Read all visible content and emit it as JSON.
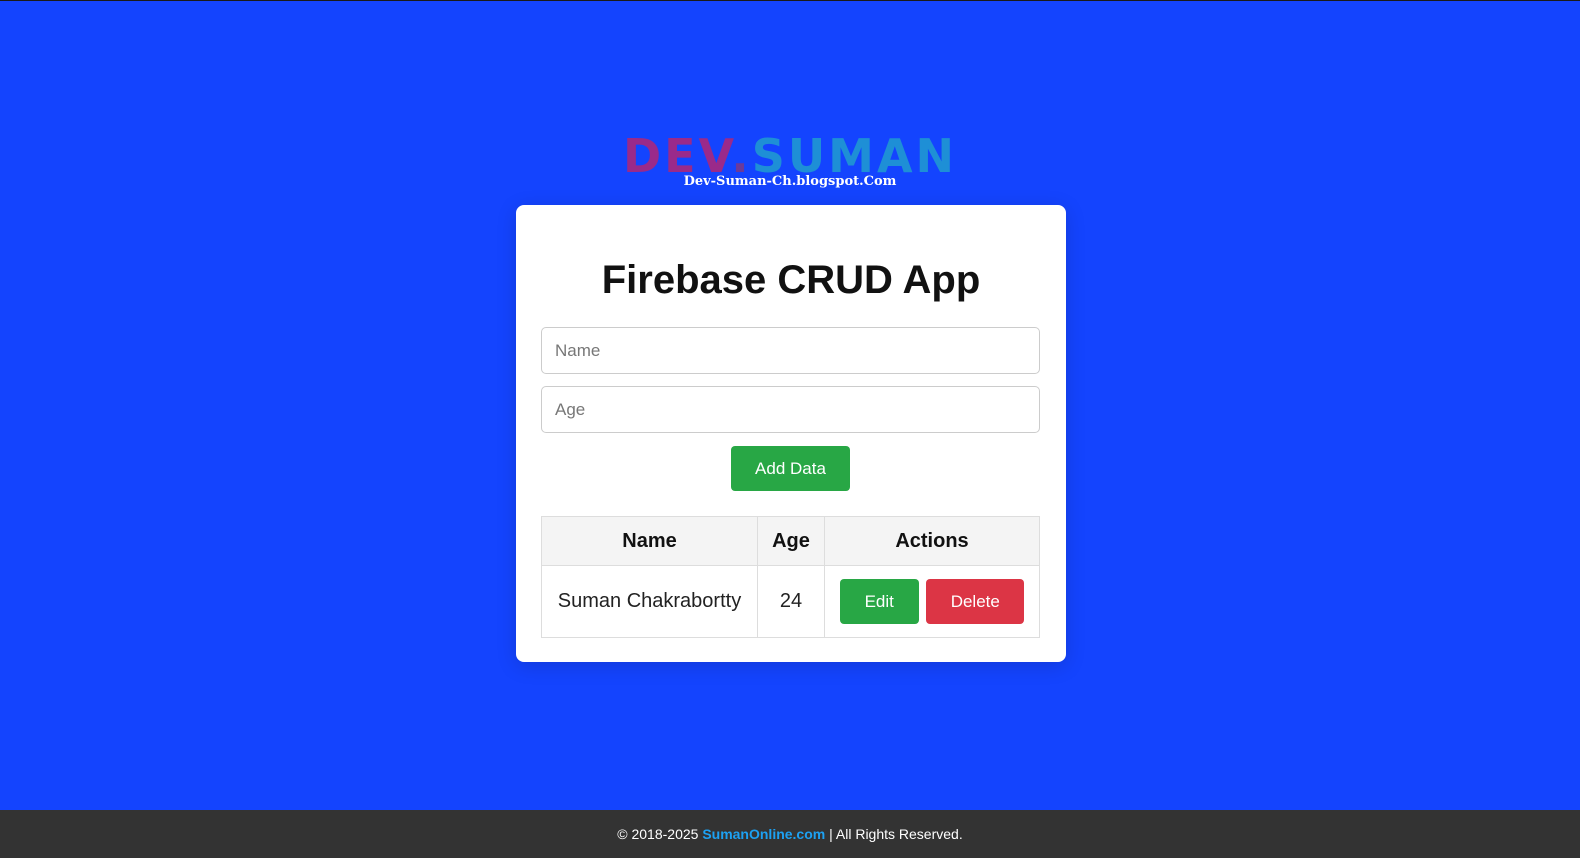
{
  "logo": {
    "dev": "DEV",
    "dot": ".",
    "suman": "SUMAN",
    "subtitle": "Dev-Suman-Ch.blogspot.Com"
  },
  "app": {
    "title": "Firebase CRUD App",
    "name_placeholder": "Name",
    "age_placeholder": "Age",
    "add_button": "Add Data"
  },
  "table": {
    "headers": [
      "Name",
      "Age",
      "Actions"
    ],
    "rows": [
      {
        "name": "Suman Chakrabortty",
        "age": "24",
        "edit_label": "Edit",
        "delete_label": "Delete"
      }
    ]
  },
  "footer": {
    "copyright": "© 2018-2025",
    "link_text": "SumanOnline.com",
    "rights": "| All Rights Reserved."
  },
  "colors": {
    "background": "#1444fe",
    "add_button": "#28a745",
    "edit_button": "#28a745",
    "delete_button": "#dc3545",
    "footer_bg": "#333333",
    "footer_link": "#1da1f2"
  }
}
